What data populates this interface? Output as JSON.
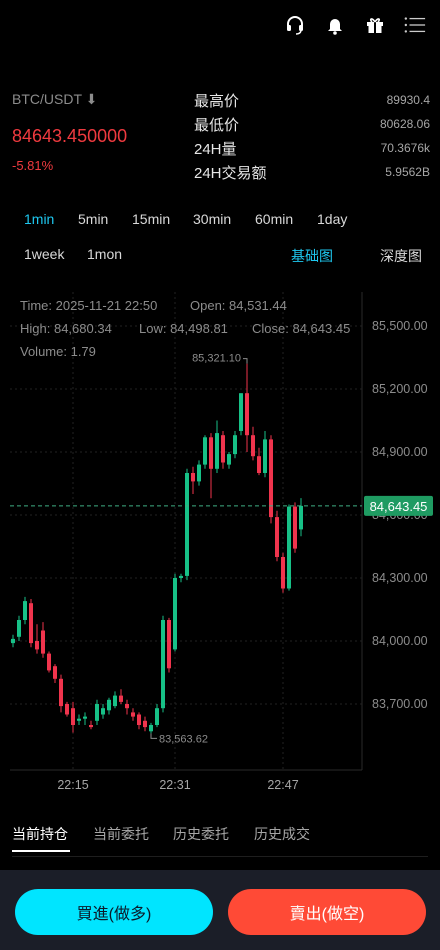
{
  "header": {
    "icons": [
      "headset-icon",
      "bell-icon",
      "gift-icon",
      "menu-icon"
    ]
  },
  "ticker": {
    "pair": "BTC/USDT ⬇",
    "price": "84643.450000",
    "change": "-5.81%"
  },
  "stats": [
    {
      "label": "最高价",
      "value": "89930.4"
    },
    {
      "label": "最低价",
      "value": "80628.06"
    },
    {
      "label": "24H量",
      "value": "70.3676k"
    },
    {
      "label": "24H交易额",
      "value": "5.9562B"
    }
  ],
  "intervals": [
    "1min",
    "5min",
    "15min",
    "30min",
    "60min",
    "1day",
    "1week",
    "1mon"
  ],
  "active_interval": "1min",
  "views": {
    "basic": "基础图",
    "depth": "深度图"
  },
  "info": {
    "time": "Time: 2025-11-21 22:50",
    "open": "Open: 84,531.44",
    "high": "High: 84,680.34",
    "low": "Low: 84,498.81",
    "close": "Close: 84,643.45",
    "volume": "Volume: 1.79"
  },
  "chart_data": {
    "type": "candlestick",
    "y_ticks": [
      "85,500.00",
      "85,200.00",
      "84,900.00",
      "84,600.00",
      "84,300.00",
      "84,000.00",
      "83,700.00"
    ],
    "x_ticks": [
      "22:15",
      "22:31",
      "22:47"
    ],
    "current_price_label": "84,643.45",
    "max_label": "85,321.10",
    "min_label": "83,563.62",
    "up_color": "#17c187",
    "down_color": "#f0344d",
    "candles": [
      [
        83990,
        84030,
        83970,
        84010
      ],
      [
        84020,
        84120,
        84000,
        84100
      ],
      [
        84100,
        84210,
        84080,
        84190
      ],
      [
        84180,
        84200,
        83970,
        83990
      ],
      [
        84000,
        84080,
        83940,
        83960
      ],
      [
        84050,
        84090,
        83920,
        83940
      ],
      [
        83940,
        83950,
        83850,
        83860
      ],
      [
        83880,
        83890,
        83800,
        83820
      ],
      [
        83820,
        83840,
        83660,
        83690
      ],
      [
        83700,
        83710,
        83640,
        83650
      ],
      [
        83680,
        83710,
        83563.62,
        83600
      ],
      [
        83620,
        83650,
        83600,
        83630
      ],
      [
        83630,
        83660,
        83600,
        83640
      ],
      [
        83600,
        83620,
        83580,
        83590
      ],
      [
        83620,
        83720,
        83600,
        83700
      ],
      [
        83650,
        83700,
        83630,
        83680
      ],
      [
        83670,
        83730,
        83650,
        83720
      ],
      [
        83690,
        83760,
        83680,
        83740
      ],
      [
        83740,
        83770,
        83700,
        83710
      ],
      [
        83700,
        83720,
        83650,
        83680
      ],
      [
        83660,
        83680,
        83620,
        83640
      ],
      [
        83650,
        83660,
        83580,
        83600
      ],
      [
        83620,
        83640,
        83570,
        83590
      ],
      [
        83570,
        83610,
        83560,
        83600
      ],
      [
        83600,
        83700,
        83590,
        83680
      ],
      [
        83680,
        84120,
        83660,
        84100
      ],
      [
        84100,
        84110,
        83850,
        83870
      ],
      [
        83960,
        84320,
        83950,
        84300
      ],
      [
        84300,
        84320,
        84280,
        84310
      ],
      [
        84310,
        84820,
        84290,
        84800
      ],
      [
        84800,
        84830,
        84700,
        84760
      ],
      [
        84760,
        84860,
        84740,
        84840
      ],
      [
        84840,
        84980,
        84820,
        84970
      ],
      [
        84970,
        84990,
        84680,
        84820
      ],
      [
        84820,
        85050,
        84800,
        84990
      ],
      [
        84980,
        85000,
        84820,
        84850
      ],
      [
        84840,
        84900,
        84820,
        84890
      ],
      [
        84890,
        85000,
        84870,
        84980
      ],
      [
        85000,
        85180,
        84980,
        85180
      ],
      [
        85180,
        85321.1,
        84900,
        84980
      ],
      [
        84980,
        85020,
        84860,
        84880
      ],
      [
        84880,
        84920,
        84790,
        84800
      ],
      [
        84800,
        85000,
        84780,
        84960
      ],
      [
        84960,
        84980,
        84560,
        84590
      ],
      [
        84590,
        84620,
        84380,
        84400
      ],
      [
        84400,
        84420,
        84230,
        84250
      ],
      [
        84250,
        84650,
        84240,
        84640
      ],
      [
        84640,
        84660,
        84420,
        84440
      ],
      [
        84531.44,
        84680.34,
        84498.81,
        84643.45
      ]
    ]
  },
  "tabs": [
    "当前持仓",
    "当前委托",
    "历史委托",
    "历史成交"
  ],
  "actions": {
    "buy": "買進(做多)",
    "sell": "賣出(做空)"
  }
}
